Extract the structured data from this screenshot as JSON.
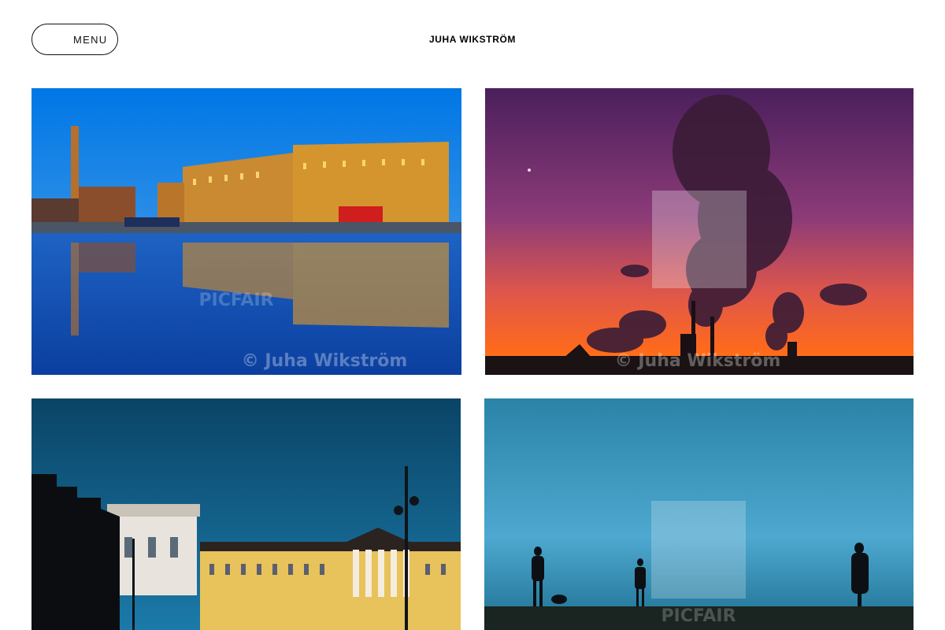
{
  "header": {
    "menu_label": "MENU",
    "site_title": "JUHA WIKSTRÖM"
  },
  "gallery": {
    "photos": [
      {
        "subject": "harbour-dock-buildings-reflection-at-dusk",
        "watermark": "© Juha Wikström",
        "brand": "PICFAIR"
      },
      {
        "subject": "industrial-chimney-smoke-at-sunset",
        "watermark": "© Juha Wikström",
        "brand": ""
      },
      {
        "subject": "neoclassical-buildings-and-street-lamps-under-blue-sky",
        "watermark": "",
        "brand": ""
      },
      {
        "subject": "silhouettes-walking-dogs-on-ridge",
        "watermark": "",
        "brand": "PICFAIR"
      }
    ]
  },
  "colors": {
    "background": "#ffffff",
    "text": "#111111",
    "accent_blue_sky": "#0a6fd6",
    "sunset_orange": "#ff6a1a"
  },
  "icons": {
    "picfair_logo": "picfair-logo-icon"
  }
}
